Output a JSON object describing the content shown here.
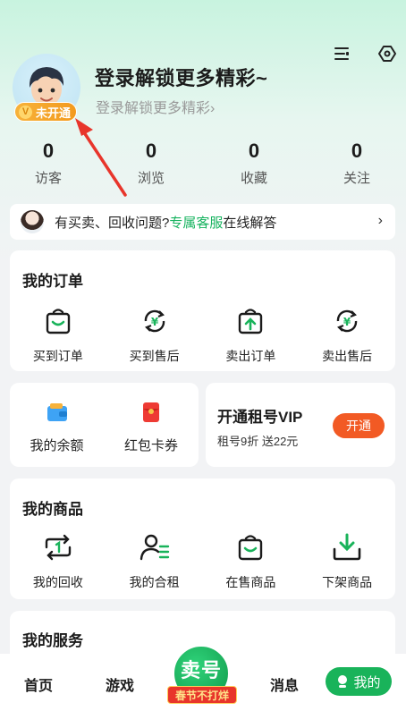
{
  "header": {
    "login_title": "登录解锁更多精彩~",
    "login_sub": "登录解锁更多精彩",
    "vip_badge": "未开通",
    "vip_badge_letter": "V"
  },
  "stats": [
    {
      "num": "0",
      "label": "访客"
    },
    {
      "num": "0",
      "label": "浏览"
    },
    {
      "num": "0",
      "label": "收藏"
    },
    {
      "num": "0",
      "label": "关注"
    }
  ],
  "service": {
    "prefix": "有买卖、回收问题?",
    "link": "专属客服",
    "suffix": "在线解答",
    "chevron": "›"
  },
  "orders": {
    "title": "我的订单",
    "items": [
      {
        "label": "买到订单",
        "icon": "shopping-bag-icon"
      },
      {
        "label": "买到售后",
        "icon": "yuan-refresh-icon"
      },
      {
        "label": "卖出订单",
        "icon": "upload-bag-icon"
      },
      {
        "label": "卖出售后",
        "icon": "yuan-refresh-icon"
      }
    ]
  },
  "wallet": {
    "balance_label": "我的余额",
    "coupon_label": "红包卡券"
  },
  "vip_promo": {
    "title": "开通租号VIP",
    "sub": "租号9折 送22元",
    "button": "开通"
  },
  "goods": {
    "title": "我的商品",
    "items": [
      {
        "label": "我的回收",
        "icon": "recycle-icon"
      },
      {
        "label": "我的合租",
        "icon": "co-rent-icon"
      },
      {
        "label": "在售商品",
        "icon": "on-sale-bag-icon"
      },
      {
        "label": "下架商品",
        "icon": "download-tray-icon"
      }
    ]
  },
  "services_card": {
    "title": "我的服务"
  },
  "nav": {
    "home": "首页",
    "games": "游戏",
    "sell": "卖号",
    "sell_tag": "春节不打烊",
    "messages": "消息",
    "mine": "我的"
  },
  "colors": {
    "accent_green": "#19b35a",
    "promo_orange": "#f25a24",
    "badge_orange": "#f39a1e",
    "annotation_red": "#e8352b"
  }
}
